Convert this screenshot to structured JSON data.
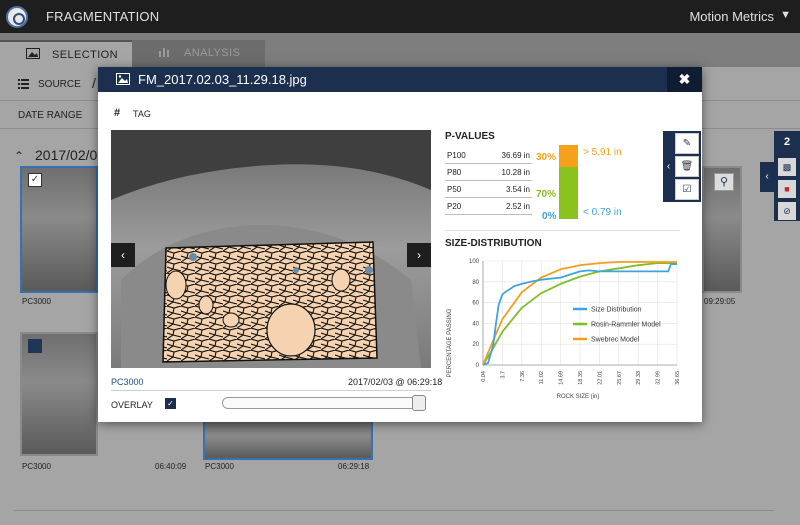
{
  "topbar": {
    "app_title": "FRAGMENTATION",
    "user_name": "Motion Metrics",
    "caret": "⌄"
  },
  "tabs": [
    {
      "label": "SELECTION"
    },
    {
      "label": "ANALYSIS"
    }
  ],
  "source": {
    "label": "SOURCE",
    "path": "/"
  },
  "filters": {
    "date_range_label": "DATE RANGE"
  },
  "gallery": {
    "date_heading": "2017/02/0",
    "items": [
      {
        "camera": "PC3000",
        "time": "",
        "checked": true
      },
      {
        "camera": "",
        "time": "09:29:05",
        "checked": false
      },
      {
        "camera": "PC3000",
        "time": "06:40:09",
        "checked": false
      },
      {
        "camera": "PC3000",
        "time": "06:29:18",
        "checked": false
      }
    ]
  },
  "right_panel": {
    "count": "2",
    "icons": [
      "bar-chart-icon",
      "save-icon",
      "block-icon"
    ]
  },
  "modal": {
    "title": "FM_2017.02.03_11.29.18.jpg",
    "close": "✖",
    "tag_hash": "#",
    "tag_label": "TAG",
    "photo_source": "PC3000",
    "photo_time": "2017/02/03 @ 06:29:18",
    "overlay_label": "OVERLAY",
    "overlay_checked": true,
    "overlay_opacity": 0.97,
    "prev": "‹",
    "next": "›"
  },
  "p_values": {
    "title": "P-VALUES",
    "rows": [
      {
        "key": "P100",
        "value": "36.69 in"
      },
      {
        "key": "P80",
        "value": "10.28 in"
      },
      {
        "key": "P50",
        "value": "3.54 in"
      },
      {
        "key": "P20",
        "value": "2.52 in"
      }
    ],
    "oversize_pct": "30%",
    "mid_pct": "70%",
    "under_pct": "0%",
    "oversize_label": "> 5.91 in",
    "under_label": "< 0.79 in",
    "colors": {
      "oversize": "#f7a11a",
      "mid": "#8cc21e",
      "under": "#3fa3e0"
    }
  },
  "chart_data": {
    "type": "line",
    "title": "SIZE-DISTRIBUTION",
    "xlabel": "ROCK SIZE (in)",
    "ylabel": "PERCENTAGE PASSING",
    "x_ticks": [
      "0.04",
      "3.7",
      "7.36",
      "11.02",
      "14.69",
      "18.35",
      "22.01",
      "25.67",
      "29.33",
      "32.99",
      "36.65"
    ],
    "y_ticks": [
      0,
      20,
      40,
      60,
      80,
      100
    ],
    "xlim": [
      0.04,
      36.65
    ],
    "ylim": [
      0,
      100
    ],
    "grid": true,
    "legend_position": "right",
    "series": [
      {
        "name": "Size Distribution",
        "color": "#3fa3e0",
        "x": [
          0.04,
          1.0,
          2.0,
          2.5,
          3.0,
          3.7,
          4.5,
          6.0,
          7.36,
          9.0,
          11.02,
          14.69,
          16.5,
          18.35,
          20.0,
          22.01,
          25.67,
          29.33,
          32.99,
          35.0,
          35.5,
          36.65
        ],
        "y": [
          0,
          2,
          20,
          40,
          58,
          68,
          71,
          76,
          78,
          80,
          82,
          84,
          87,
          90,
          91,
          90,
          90,
          90,
          90,
          90,
          97,
          97
        ]
      },
      {
        "name": "Rosin-Rammler Model",
        "color": "#7fbd2a",
        "x": [
          0.04,
          1.5,
          3.7,
          7.36,
          11.02,
          14.69,
          18.35,
          22.01,
          25.67,
          29.33,
          32.99,
          36.65
        ],
        "y": [
          0,
          12,
          32,
          55,
          69,
          78,
          85,
          90,
          93,
          96,
          98,
          98
        ]
      },
      {
        "name": "Swebrec Model",
        "color": "#f0a020",
        "x": [
          0.04,
          1.5,
          3.7,
          7.36,
          11.02,
          14.69,
          18.35,
          22.01,
          25.67,
          29.33,
          32.99,
          36.65
        ],
        "y": [
          0,
          18,
          44,
          70,
          84,
          92,
          96,
          98,
          99,
          99,
          99,
          99
        ]
      }
    ]
  }
}
